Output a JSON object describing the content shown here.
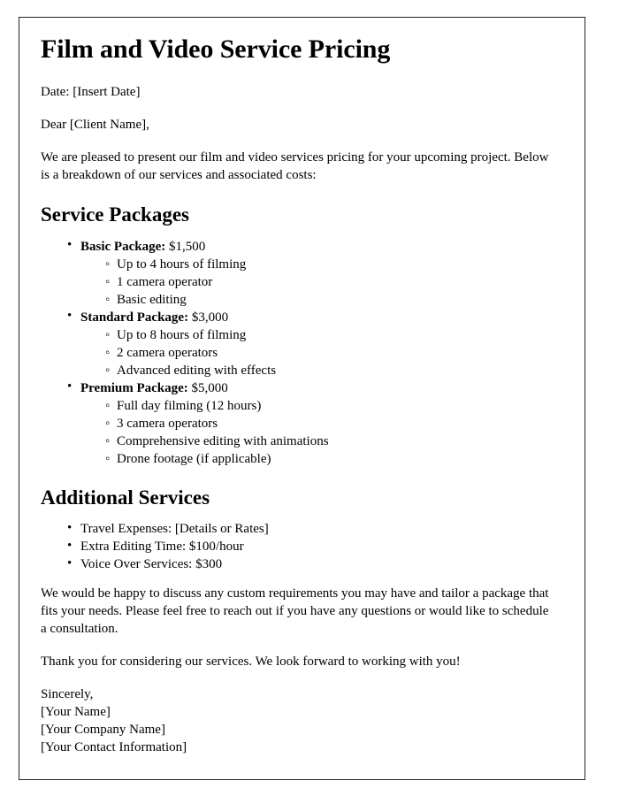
{
  "document": {
    "title": "Film and Video Service Pricing",
    "date_line": "Date: [Insert Date]",
    "salutation": "Dear [Client Name],",
    "intro_paragraph": "We are pleased to present our film and video services pricing for your upcoming project. Below is a breakdown of our services and associated costs:",
    "service_packages": {
      "heading": "Service Packages",
      "packages": [
        {
          "name": "Basic Package:",
          "price": "$1,500",
          "features": [
            "Up to 4 hours of filming",
            "1 camera operator",
            "Basic editing"
          ]
        },
        {
          "name": "Standard Package:",
          "price": "$3,000",
          "features": [
            "Up to 8 hours of filming",
            "2 camera operators",
            "Advanced editing with effects"
          ]
        },
        {
          "name": "Premium Package:",
          "price": "$5,000",
          "features": [
            "Full day filming (12 hours)",
            "3 camera operators",
            "Comprehensive editing with animations",
            "Drone footage (if applicable)"
          ]
        }
      ]
    },
    "additional_services": {
      "heading": "Additional Services",
      "items": [
        "Travel Expenses: [Details or Rates]",
        "Extra Editing Time: $100/hour",
        "Voice Over Services: $300"
      ]
    },
    "closing_paragraph": "We would be happy to discuss any custom requirements you may have and tailor a package that fits your needs. Please feel free to reach out if you have any questions or would like to schedule a consultation.",
    "thank_you_paragraph": "Thank you for considering our services. We look forward to working with you!",
    "signature": {
      "closing": "Sincerely,",
      "name": "[Your Name]",
      "company": "[Your Company Name]",
      "contact": "[Your Contact Information]"
    }
  },
  "style": {
    "border_color": "#242424",
    "text_color": "#000000",
    "page_background": "#ffffff"
  }
}
